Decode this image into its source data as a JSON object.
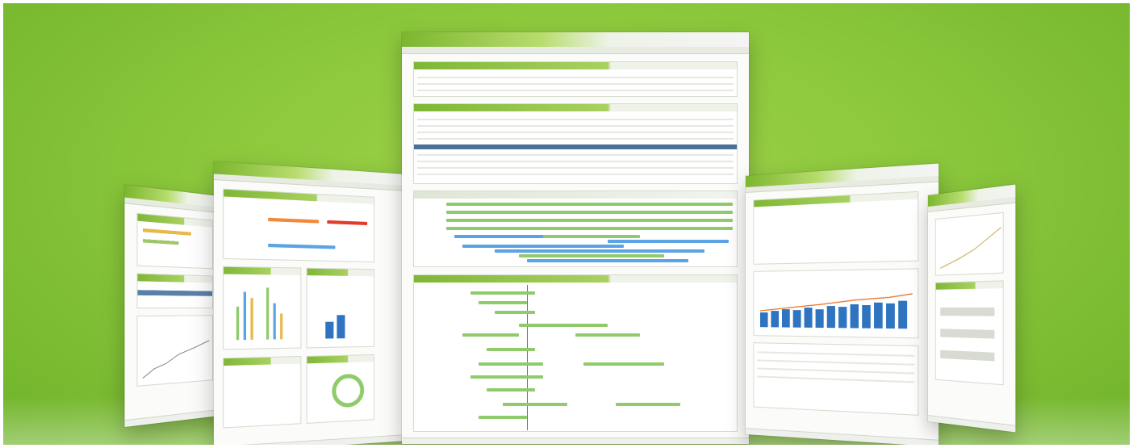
{
  "scene": {
    "description_visible_text": "",
    "colors": {
      "background": "#8cc83c",
      "accent_green": "#7fb735",
      "bar_green": "#8fcb6a",
      "bar_blue": "#5aa3e4",
      "marker_red": "#e23a2c"
    }
  },
  "screens": {
    "center": {
      "brand": ""
    },
    "left_back": {
      "brand": ""
    },
    "left_front": {
      "brand": ""
    },
    "right_front": {
      "brand": ""
    },
    "right_back": {
      "brand": ""
    }
  }
}
